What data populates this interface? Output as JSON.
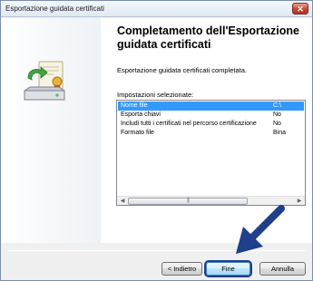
{
  "window": {
    "title": "Esportazione guidata certificati",
    "close_icon": "close-icon"
  },
  "wizard": {
    "heading": "Completamento dell'Esportazione guidata certificati",
    "status_text": "Esportazione guidata certificati completata.",
    "settings_label": "Impostazioni selezionate:",
    "icon": "certificate-export-icon"
  },
  "settings_list": {
    "rows": [
      {
        "name": "Nome file",
        "value": "C:\\",
        "selected": true
      },
      {
        "name": "Esporta chiavi",
        "value": "No",
        "selected": false
      },
      {
        "name": "Includi tutti i certificati nel percorso certificazione",
        "value": "No",
        "selected": false
      },
      {
        "name": "Formato file",
        "value": "Bina",
        "selected": false
      }
    ],
    "scrollbar": {
      "left_icon": "scroll-left-icon",
      "right_icon": "scroll-right-icon"
    }
  },
  "buttons": {
    "back": "< Indietro",
    "finish": "Fine",
    "cancel": "Annulla"
  },
  "colors": {
    "selection": "#3399ff",
    "annotation_arrow": "#1f3e8c",
    "close_button": "#c7442f"
  }
}
